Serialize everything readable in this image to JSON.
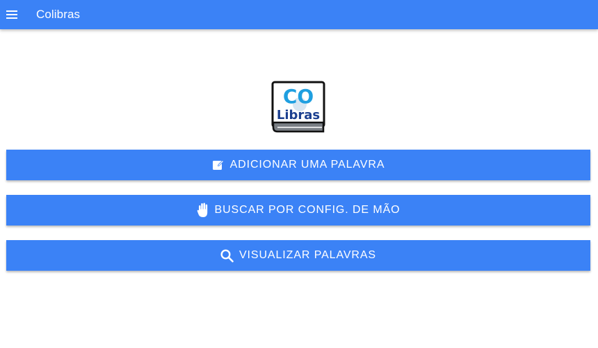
{
  "appbar": {
    "title": "Colibras",
    "menu_icon": "menu-icon"
  },
  "logo": {
    "line1": "CO",
    "line2": "Libras",
    "colors": {
      "co_text": "#1f9fe0",
      "libras_text": "#1b3f8f",
      "border": "#111111",
      "book_base": "#7a7f85"
    }
  },
  "buttons": [
    {
      "label": "ADICIONAR UMA PALAVRA",
      "icon": "edit-icon"
    },
    {
      "label": "BUSCAR POR CONFIG. DE MÃO",
      "icon": "hand-icon"
    },
    {
      "label": "VISUALIZAR PALAVRAS",
      "icon": "search-icon"
    }
  ],
  "colors": {
    "primary": "#3b82f6",
    "on_primary": "#ffffff",
    "background": "#ffffff"
  }
}
